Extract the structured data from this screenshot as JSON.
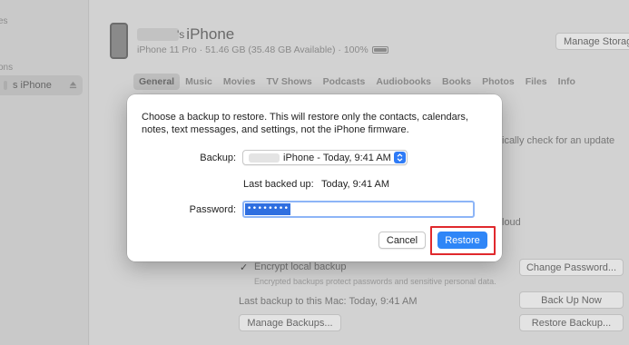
{
  "sidebar": {
    "top_fragment_1": "es",
    "top_fragment_2": "ons",
    "selected_device": "s iPhone"
  },
  "device": {
    "name": "iPhone",
    "name_prefix_fragment": "'s",
    "subtitle": "iPhone 11 Pro · 51.46 GB (35.48 GB Available) · 100%",
    "manage_storage": "Manage Storage"
  },
  "tabs": [
    "General",
    "Music",
    "Movies",
    "TV Shows",
    "Podcasts",
    "Audiobooks",
    "Books",
    "Photos",
    "Files",
    "Info"
  ],
  "background": {
    "update_text": "ically check for an update",
    "cloud_text": "loud",
    "encrypt_check": "✓",
    "encrypt_label": "Encrypt local backup",
    "encrypt_note": "Encrypted backups protect passwords and sensitive personal data.",
    "change_password": "Change Password...",
    "last_backup": "Last backup to this Mac: Today, 9:41 AM",
    "back_up_now": "Back Up Now",
    "manage_backups": "Manage Backups...",
    "restore_backup": "Restore Backup..."
  },
  "dialog": {
    "message": "Choose a backup to restore. This will restore only the contacts, calendars, notes, text messages, and settings, not the iPhone firmware.",
    "backup_label": "Backup:",
    "backup_value": "iPhone - Today, 9:41 AM",
    "last_backed_up_label": "Last backed up:",
    "last_backed_up_value": "Today, 9:41 AM",
    "password_label": "Password:",
    "password_value": "••••••••",
    "cancel": "Cancel",
    "restore": "Restore"
  },
  "colors": {
    "accent": "#2f86f7",
    "highlight": "#e0292d"
  }
}
